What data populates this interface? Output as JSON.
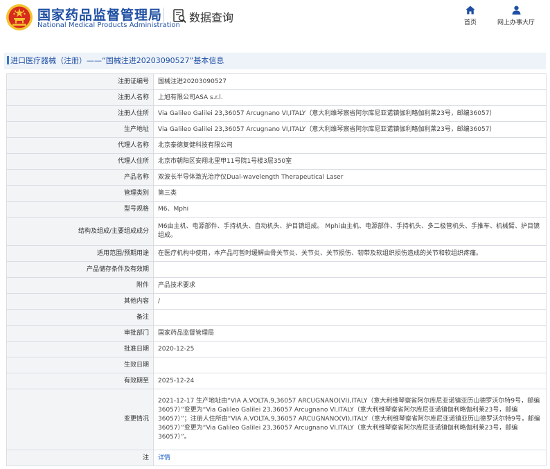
{
  "header": {
    "org_name_cn": "国家药品监督管理局",
    "org_name_en": "National Medical Products Administration",
    "section_title": "数据查询",
    "nav": [
      {
        "label": "首页",
        "icon": "home-icon"
      },
      {
        "label": "网上办事大厅",
        "icon": "user-icon"
      }
    ]
  },
  "breadcrumb": {
    "text": "进口医疗器械（注册）——“国械注进20203090527”基本信息"
  },
  "colors": {
    "brand_blue": "#1f4fa3",
    "link_blue": "#1f63c6",
    "label_bg": "#f2f4f6",
    "breadcrumb_bg": "#eef3f9",
    "border": "#d9dde3",
    "emblem_red": "#d62b1e",
    "emblem_gold": "#f4c430"
  },
  "rows": [
    {
      "label": "注册证编号",
      "value": "国械注进20203090527"
    },
    {
      "label": "注册人名称",
      "value": "上旭有限公司ASA s.r.l."
    },
    {
      "label": "注册人住所",
      "value": "Via Galileo Galilei 23,36057 Arcugnano VI,ITALY（意大利维琴察省阿尔库尼亚诺镇伽利略伽利莱23号，邮编36057）"
    },
    {
      "label": "生产地址",
      "value": "Via Galileo Galilei 23,36057 Arcugnano VI,ITALY（意大利维琴察省阿尔库尼亚诺镇伽利略伽利莱23号，邮编36057）"
    },
    {
      "label": "代理人名称",
      "value": "北京泰德复健科技有限公司"
    },
    {
      "label": "代理人住所",
      "value": "北京市朝阳区安翔北里甲11号院1号楼3层350室"
    },
    {
      "label": "产品名称",
      "value": "双波长半导体激光治疗仪Dual-wavelength Therapeutical Laser"
    },
    {
      "label": "管理类别",
      "value": "第三类"
    },
    {
      "label": "型号规格",
      "value": "M6、Mphi"
    },
    {
      "label": "结构及组成/主要组成成分",
      "value": "M6由主机、电源部件、手持机头、自动机头、护目镜组成。 Mphi由主机、电源部件、手持机头、多二极管机头、手推车、机械臂、护目镜组成。"
    },
    {
      "label": "适用范围/预期用途",
      "value": "在医疗机构中使用，本产品可暂时缓解由骨关节炎、关节炎、关节损伤、韧带及软组织损伤造成的关节和软组织疼痛。"
    },
    {
      "label": "产品储存条件及有效期",
      "value": ""
    },
    {
      "label": "附件",
      "value": "产品技术要求"
    },
    {
      "label": "其他内容",
      "value": "/"
    },
    {
      "label": "备注",
      "value": ""
    },
    {
      "label": "审批部门",
      "value": "国家药品监督管理局"
    },
    {
      "label": "批准日期",
      "value": "2020-12-25"
    },
    {
      "label": "生效日期",
      "value": ""
    },
    {
      "label": "有效期至",
      "value": "2025-12-24"
    },
    {
      "label": "变更情况",
      "value": "2021-12-17 生产地址由“VIA A.VOLTA,9,36057 ARCUGNANO(VI),ITALY（意大利维琴察省阿尔库尼亚诺镇亚历山德罗沃尔特9号，邮编36057）”变更为“Via Galileo Galilei 23,36057 Arcugnano VI,ITALY（意大利维琴察省阿尔库尼亚诺镇伽利略伽利莱23号，邮编36057）”；注册人住所由“VIA A.VOLTA,9,36057 ARCUGNANO(VI),ITALY（意大利维琴察省阿尔库尼亚诺镇亚历山德罗沃尔特9号，邮编36057）”变更为“Via Galileo Galilei 23,36057 Arcugnano VI,ITALY（意大利维琴察省阿尔库尼亚诺镇伽利略伽利莱23号，邮编36057）”。"
    },
    {
      "label": "注",
      "value": "详情",
      "link": true
    }
  ]
}
